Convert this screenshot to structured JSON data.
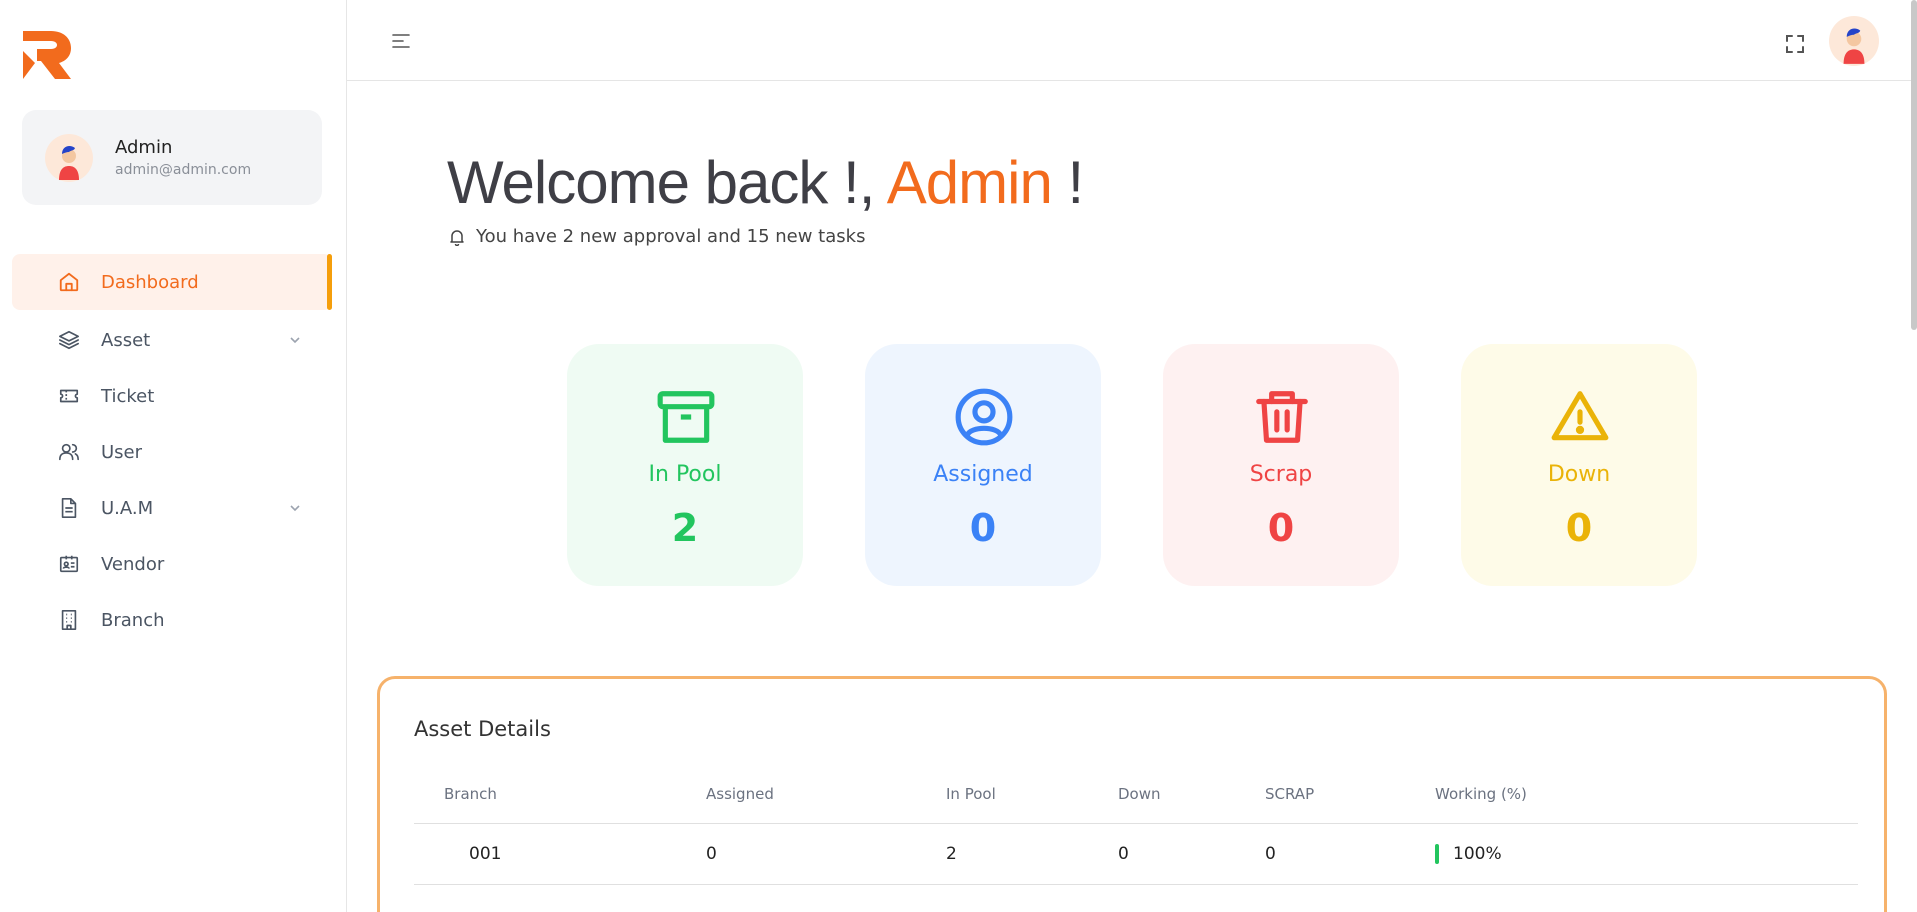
{
  "sidebar": {
    "user": {
      "name": "Admin",
      "email": "admin@admin.com"
    },
    "items": [
      {
        "label": "Dashboard",
        "icon": "home-icon",
        "active": true,
        "expandable": false
      },
      {
        "label": "Asset",
        "icon": "layers-icon",
        "active": false,
        "expandable": true
      },
      {
        "label": "Ticket",
        "icon": "ticket-icon",
        "active": false,
        "expandable": false
      },
      {
        "label": "User",
        "icon": "users-icon",
        "active": false,
        "expandable": false
      },
      {
        "label": "U.A.M",
        "icon": "document-icon",
        "active": false,
        "expandable": true
      },
      {
        "label": "Vendor",
        "icon": "id-card-icon",
        "active": false,
        "expandable": false
      },
      {
        "label": "Branch",
        "icon": "building-icon",
        "active": false,
        "expandable": false
      }
    ]
  },
  "header": {
    "menu_icon": "menu-icon",
    "fullscreen_icon": "fullscreen-icon"
  },
  "welcome": {
    "prefix": "Welcome back !, ",
    "name": "Admin",
    "suffix": " !",
    "subtitle": "You have 2 new approval and 15 new tasks"
  },
  "stats": [
    {
      "label": "In Pool",
      "value": "2",
      "icon": "archive-icon",
      "color": "#22c55e",
      "bg": "#effbf3"
    },
    {
      "label": "Assigned",
      "value": "0",
      "icon": "user-circle-icon",
      "color": "#3b82f6",
      "bg": "#eef5fe"
    },
    {
      "label": "Scrap",
      "value": "0",
      "icon": "trash-icon",
      "color": "#ef4444",
      "bg": "#fef1f1"
    },
    {
      "label": "Down",
      "value": "0",
      "icon": "warning-icon",
      "color": "#eab308",
      "bg": "#fefbe8"
    }
  ],
  "asset_details": {
    "title": "Asset Details",
    "columns": [
      "Branch",
      "Assigned",
      "In Pool",
      "Down",
      "SCRAP",
      "Working (%)"
    ],
    "rows": [
      {
        "branch": "001",
        "assigned": "0",
        "in_pool": "2",
        "down": "0",
        "scrap": "0",
        "working": "100%"
      }
    ]
  },
  "colors": {
    "accent": "#f26b1d",
    "panel_border": "#f6b26b"
  }
}
